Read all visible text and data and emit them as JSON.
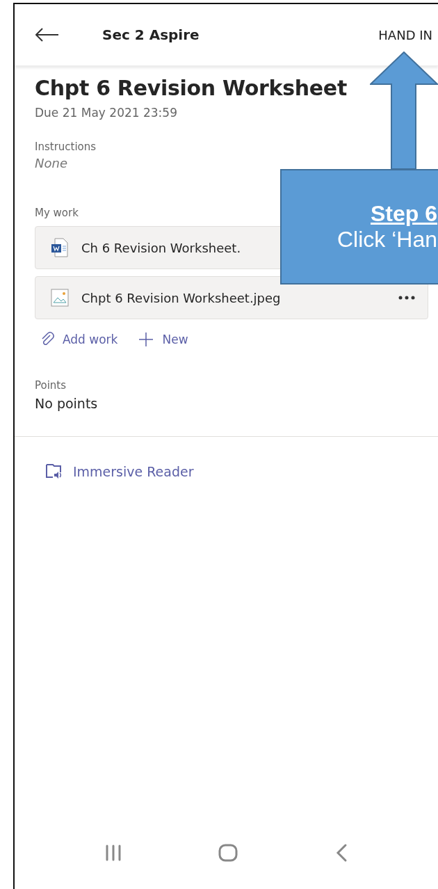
{
  "header": {
    "title": "Sec 2 Aspire",
    "action": "HAND IN"
  },
  "assignment": {
    "title": "Chpt 6 Revision Worksheet",
    "due": "Due 21 May 2021 23:59"
  },
  "instructions": {
    "label": "Instructions",
    "value": "None"
  },
  "my_work": {
    "label": "My work",
    "files": [
      {
        "name": "Ch 6 Revision Worksheet.",
        "kind": "word"
      },
      {
        "name": "Chpt 6 Revision Worksheet.jpeg",
        "kind": "image",
        "menu": true
      }
    ],
    "actions": [
      {
        "label": "Add work",
        "kind": "attach"
      },
      {
        "label": "New",
        "kind": "new"
      }
    ]
  },
  "points": {
    "label": "Points",
    "value": "No points"
  },
  "immersive_reader": "Immersive Reader",
  "callout": {
    "step": "Step 6",
    "text": "Click ‘Han"
  }
}
